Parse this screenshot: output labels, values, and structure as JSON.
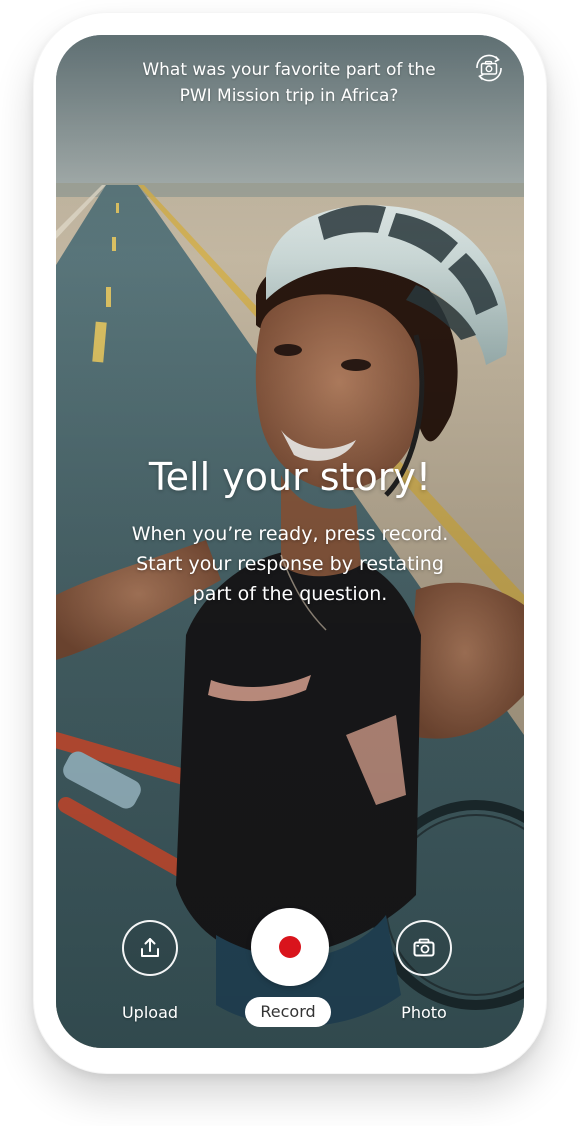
{
  "prompt": {
    "question": "What was your favorite part of the\nPWI Mission trip in Africa?"
  },
  "camera": {
    "flip_icon": "flip-camera-icon"
  },
  "overlay": {
    "headline": "Tell your story!",
    "instructions": "When you’re ready, press record.\nStart your response by restating\npart of the question."
  },
  "controls": {
    "upload_label": "Upload",
    "record_label": "Record",
    "photo_label": "Photo",
    "upload_icon": "upload-icon",
    "record_icon": "record-dot-icon",
    "photo_icon": "camera-icon",
    "record_color": "#d9141c"
  }
}
